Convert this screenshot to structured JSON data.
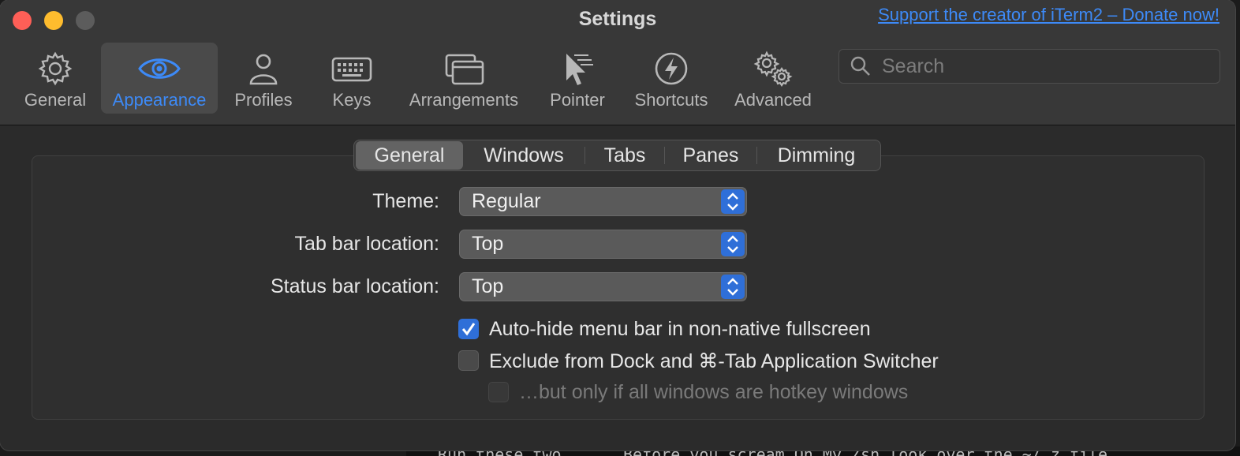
{
  "window": {
    "title": "Settings",
    "donate_link": "Support the creator of iTerm2 – Donate now!"
  },
  "toolbar": [
    {
      "label": "General",
      "icon": "gear-icon"
    },
    {
      "label": "Appearance",
      "icon": "eye-icon",
      "active": true
    },
    {
      "label": "Profiles",
      "icon": "person-icon"
    },
    {
      "label": "Keys",
      "icon": "keyboard-icon"
    },
    {
      "label": "Arrangements",
      "icon": "windows-icon"
    },
    {
      "label": "Pointer",
      "icon": "pointer-icon"
    },
    {
      "label": "Shortcuts",
      "icon": "bolt-icon"
    },
    {
      "label": "Advanced",
      "icon": "gears-icon"
    }
  ],
  "search": {
    "placeholder": "Search"
  },
  "segments": [
    {
      "label": "General",
      "active": true
    },
    {
      "label": "Windows"
    },
    {
      "label": "Tabs"
    },
    {
      "label": "Panes"
    },
    {
      "label": "Dimming"
    }
  ],
  "form": {
    "theme": {
      "label": "Theme:",
      "value": "Regular"
    },
    "tab_bar_location": {
      "label": "Tab bar location:",
      "value": "Top"
    },
    "status_bar_location": {
      "label": "Status bar location:",
      "value": "Top"
    }
  },
  "checkboxes": {
    "auto_hide": {
      "label": "Auto-hide menu bar in non-native fullscreen",
      "checked": true
    },
    "exclude_dock": {
      "label": "Exclude from Dock and ⌘-Tab Application Switcher",
      "checked": false
    },
    "hotkey_only": {
      "label": "…but only if all windows are hotkey windows",
      "checked": false,
      "enabled": false
    }
  },
  "background_terminal": {
    "left_text": "Run these two",
    "right_text": "Before you scream Oh My Zsh look over the  ~/.z  file"
  },
  "colors": {
    "accent": "#3d8af7",
    "checkbox_on": "#2f6fd8",
    "close": "#fe5f57",
    "minimize": "#febc2e"
  }
}
